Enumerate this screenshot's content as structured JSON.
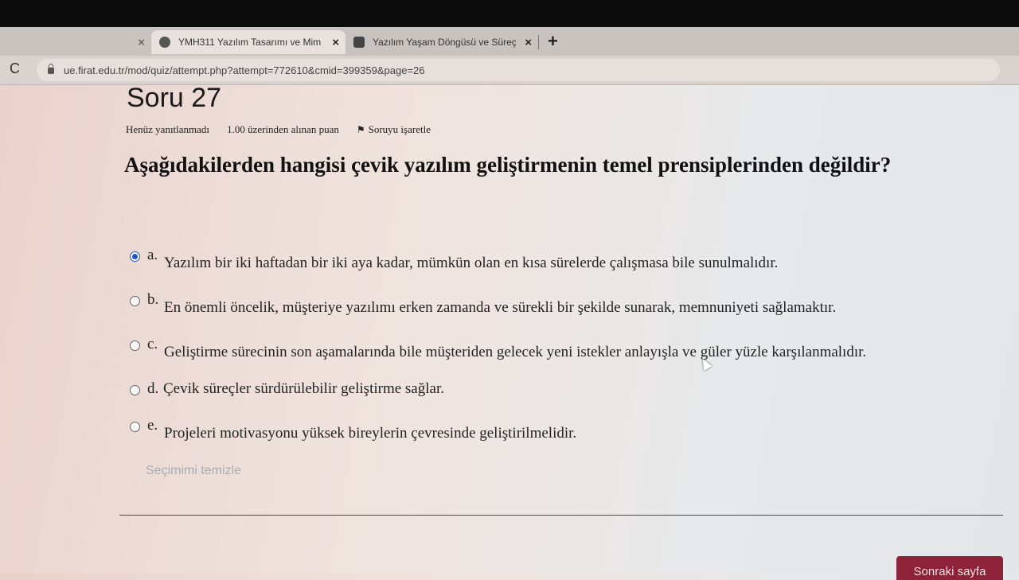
{
  "browser": {
    "tabs": [
      {
        "title": "",
        "state": "faded"
      },
      {
        "title": "YMH311 Yazılım Tasarımı ve Mim",
        "state": "active"
      },
      {
        "title": "Yazılım Yaşam Döngüsü ve Süreç",
        "state": "inactive"
      }
    ],
    "close_glyph": "×",
    "new_tab_glyph": "+",
    "reload_glyph": "C",
    "url": "ue.firat.edu.tr/mod/quiz/attempt.php?attempt=772610&cmid=399359&page=26"
  },
  "question": {
    "title": "Soru 27",
    "status": "Henüz yanıtlanmadı",
    "grade": "1.00 üzerinden alınan puan",
    "flag_label": "Soruyu işaretle",
    "text": "Aşağıdakilerden hangisi çevik yazılım geliştirmenin temel prensiplerinden değildir?",
    "answers": [
      {
        "letter": "a.",
        "text": "Yazılım bir iki haftadan bir iki aya kadar, mümkün olan en kısa sürelerde çalışmasa bile sunulmalıdır.",
        "selected": true
      },
      {
        "letter": "b.",
        "text": "En önemli öncelik, müşteriye yazılımı erken zamanda ve sürekli bir şekilde sunarak, memnuniyeti sağlamaktır.",
        "selected": false
      },
      {
        "letter": "c.",
        "text": "Geliştirme sürecinin son aşamalarında bile müşteriden gelecek yeni istekler anlayışla ve güler yüzle karşılanmalıdır.",
        "selected": false
      },
      {
        "letter": "d.",
        "text": "Çevik süreçler sürdürülebilir geliştirme sağlar.",
        "selected": false
      },
      {
        "letter": "e.",
        "text": "Projeleri motivasyonu yüksek bireylerin çevresinde geliştirilmelidir.",
        "selected": false
      }
    ],
    "clear_choice": "Seçimimi temizle"
  },
  "navigation": {
    "next_page": "Sonraki sayfa"
  },
  "colors": {
    "accent_radio": "#1e57c7",
    "next_button": "#8e2238"
  }
}
